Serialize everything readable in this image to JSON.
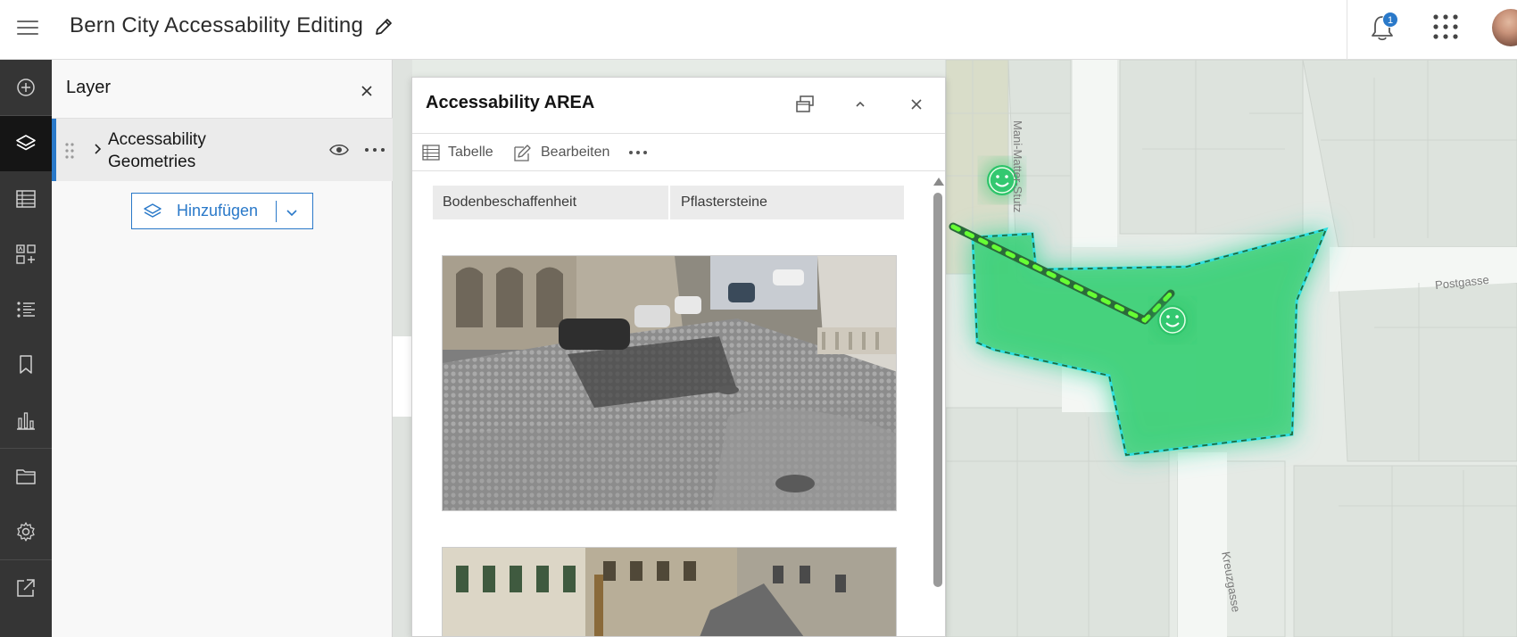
{
  "header": {
    "title": "Bern City Accessability Editing",
    "notification_count": "1"
  },
  "toolbar": {
    "tools": [
      "add-data",
      "layers",
      "tables",
      "legend",
      "list",
      "bookmarks",
      "charts",
      "files",
      "settings",
      "share"
    ],
    "active": "layers"
  },
  "layer_panel": {
    "title": "Layer",
    "layers": [
      {
        "name": "Accessability Geometries"
      }
    ],
    "add_button_label": "Hinzufügen"
  },
  "popup": {
    "title": "Accessability AREA",
    "actions": {
      "table": "Tabelle",
      "edit": "Bearbeiten"
    },
    "attributes": [
      {
        "key": "Bodenbeschaffenheit",
        "value": "Pflastersteine"
      }
    ]
  },
  "map": {
    "streets": [
      "Mani-Matter-Stutz",
      "Postgasse",
      "Kreuzgasse"
    ],
    "colors": {
      "area_fill": "#3fd17a",
      "area_outline": "#2fe0e0",
      "line_highlight": "#66ff33",
      "accent": "#2a79c9"
    }
  }
}
